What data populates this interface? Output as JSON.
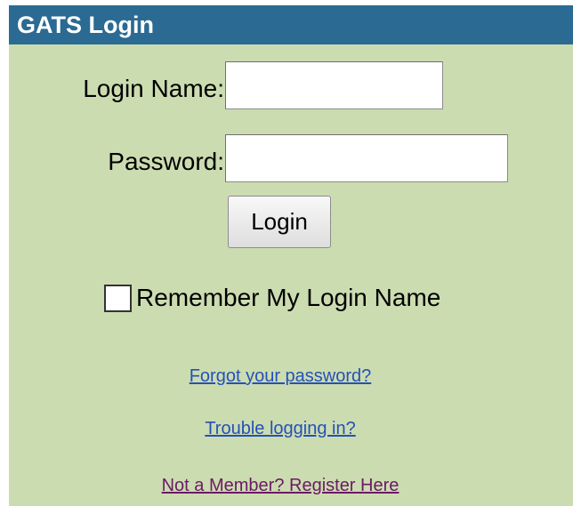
{
  "header": {
    "title": "GATS Login"
  },
  "form": {
    "login_name_label": "Login Name:",
    "login_name_value": "",
    "password_label": "Password:",
    "password_value": "",
    "login_button": "Login",
    "remember_label": "Remember My Login Name",
    "remember_checked": false
  },
  "links": {
    "forgot_password": "Forgot your password?",
    "trouble_logging_in": "Trouble logging in?",
    "register": "Not a Member? Register Here"
  },
  "colors": {
    "header_bg": "#2b6a92",
    "panel_bg": "#ccdcb1",
    "link_blue": "#2451b8",
    "link_visited": "#6b1a64"
  }
}
